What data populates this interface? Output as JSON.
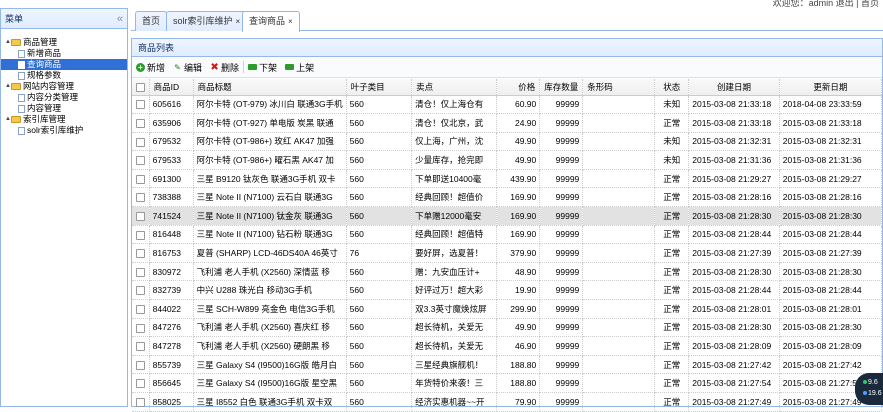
{
  "top": {
    "welcome": "欢迎您：admin 退出 | 首页"
  },
  "west": {
    "title": "菜单",
    "collapse_icon": "«",
    "tree": [
      {
        "label": "商品管理",
        "type": "folder",
        "level": 0,
        "toggle": "▲"
      },
      {
        "label": "新增商品",
        "type": "file",
        "level": 1
      },
      {
        "label": "查询商品",
        "type": "file",
        "level": 1,
        "selected": true
      },
      {
        "label": "规格参数",
        "type": "file",
        "level": 1
      },
      {
        "label": "网站内容管理",
        "type": "folder",
        "level": 0,
        "toggle": "▲"
      },
      {
        "label": "内容分类管理",
        "type": "file",
        "level": 1
      },
      {
        "label": "内容管理",
        "type": "file",
        "level": 1
      },
      {
        "label": "索引库管理",
        "type": "folder",
        "level": 0,
        "toggle": "▲"
      },
      {
        "label": "solr索引库维护",
        "type": "file",
        "level": 1
      }
    ]
  },
  "tabs": [
    {
      "label": "首页",
      "closable": false
    },
    {
      "label": "solr索引库维护",
      "closable": true
    },
    {
      "label": "查询商品",
      "closable": true,
      "active": true
    }
  ],
  "panel": {
    "title": "商品列表"
  },
  "toolbar": {
    "add": "新增",
    "edit": "编辑",
    "delete": "删除",
    "down": "下架",
    "up": "上架"
  },
  "table": {
    "columns": [
      "商品ID",
      "商品标题",
      "叶子类目",
      "卖点",
      "价格",
      "库存数量",
      "条形码",
      "状态",
      "创建日期",
      "更新日期"
    ],
    "rows": [
      [
        "605616",
        "阿尔卡特 (OT-979) 冰川白 联通3G手机",
        "560",
        "清仓！仅上海仓有",
        "60.90",
        "99999",
        "",
        "未知",
        "2015-03-08 21:33:18",
        "2018-04-08 23:33:59"
      ],
      [
        "635906",
        "阿尔卡特 (OT-927) 单电版 炭黑 联通",
        "560",
        "清仓！仅北京，武",
        "24.90",
        "99999",
        "",
        "正常",
        "2015-03-08 21:33:18",
        "2015-03-08 21:33:18"
      ],
      [
        "679532",
        "阿尔卡特 (OT-986+) 玫红 AK47 加强",
        "560",
        "仅上海，广州，沈",
        "49.90",
        "99999",
        "",
        "未知",
        "2015-03-08 21:32:31",
        "2015-03-08 21:32:31"
      ],
      [
        "679533",
        "阿尔卡特 (OT-986+) 曜石黑 AK47 加",
        "560",
        "少量库存，抢完即",
        "49.90",
        "99999",
        "",
        "未知",
        "2015-03-08 21:31:36",
        "2015-03-08 21:31:36"
      ],
      [
        "691300",
        "三星 B9120 钛灰色 联通3G手机 双卡",
        "560",
        "下单即送10400毫",
        "439.90",
        "99999",
        "",
        "正常",
        "2015-03-08 21:29:27",
        "2015-03-08 21:29:27"
      ],
      [
        "738388",
        "三星 Note II (N7100) 云石白 联通3G",
        "560",
        "经典回顾！超值价",
        "169.90",
        "99999",
        "",
        "正常",
        "2015-03-08 21:28:16",
        "2015-03-08 21:28:16"
      ],
      [
        "741524",
        "三星 Note II (N7100) 钛金灰 联通3G",
        "560",
        "下单赠12000毫安",
        "169.90",
        "99999",
        "",
        "正常",
        "2015-03-08 21:28:30",
        "2015-03-08 21:28:30"
      ],
      [
        "816448",
        "三星 Note II (N7100) 钻石粉 联通3G",
        "560",
        "经典回顾！超值特",
        "169.90",
        "99999",
        "",
        "正常",
        "2015-03-08 21:28:44",
        "2015-03-08 21:28:44"
      ],
      [
        "816753",
        "夏普 (SHARP) LCD-46DS40A 46英寸",
        "76",
        "要好屏，选夏普！",
        "379.90",
        "99999",
        "",
        "正常",
        "2015-03-08 21:27:39",
        "2015-03-08 21:27:39"
      ],
      [
        "830972",
        "飞利浦 老人手机 (X2560) 深情蓝 移",
        "560",
        "赠：九安血压计+",
        "48.90",
        "99999",
        "",
        "正常",
        "2015-03-08 21:28:30",
        "2015-03-08 21:28:30"
      ],
      [
        "832739",
        "中兴 U288 珠光白 移动3G手机",
        "560",
        "好评过万！超大彩",
        "19.90",
        "99999",
        "",
        "正常",
        "2015-03-08 21:28:44",
        "2015-03-08 21:28:44"
      ],
      [
        "844022",
        "三星 SCH-W899 亮金色 电信3G手机",
        "560",
        "双3.3英寸魔焕炫屏",
        "299.90",
        "99999",
        "",
        "正常",
        "2015-03-08 21:28:01",
        "2015-03-08 21:28:01"
      ],
      [
        "847276",
        "飞利浦 老人手机 (X2560) 喜庆红 移",
        "560",
        "超长待机，关爱无",
        "49.90",
        "99999",
        "",
        "正常",
        "2015-03-08 21:28:30",
        "2015-03-08 21:28:30"
      ],
      [
        "847278",
        "飞利浦 老人手机 (X2560) 硬朗黑 移",
        "560",
        "超长待机，关爱无",
        "46.90",
        "99999",
        "",
        "正常",
        "2015-03-08 21:28:09",
        "2015-03-08 21:28:09"
      ],
      [
        "855739",
        "三星 Galaxy S4 (I9500)16G版 皓月白",
        "560",
        "三星经典旗舰机！",
        "188.80",
        "99999",
        "",
        "正常",
        "2015-03-08 21:27:42",
        "2015-03-08 21:27:42"
      ],
      [
        "856645",
        "三星 Galaxy S4 (I9500)16G版 星空黑",
        "560",
        "年货特价来袭！三",
        "188.80",
        "99999",
        "",
        "正常",
        "2015-03-08 21:27:54",
        "2015-03-08 21:27:54"
      ],
      [
        "858025",
        "三星 I8552 白色 联通3G手机 双卡双",
        "560",
        "经济实惠机器~~开",
        "79.90",
        "99999",
        "",
        "正常",
        "2015-03-08 21:27:49",
        "2015-03-08 21:27:49"
      ]
    ],
    "highlighted_row": 6
  },
  "badge": {
    "line1": "9.6",
    "line2": "19.6"
  }
}
